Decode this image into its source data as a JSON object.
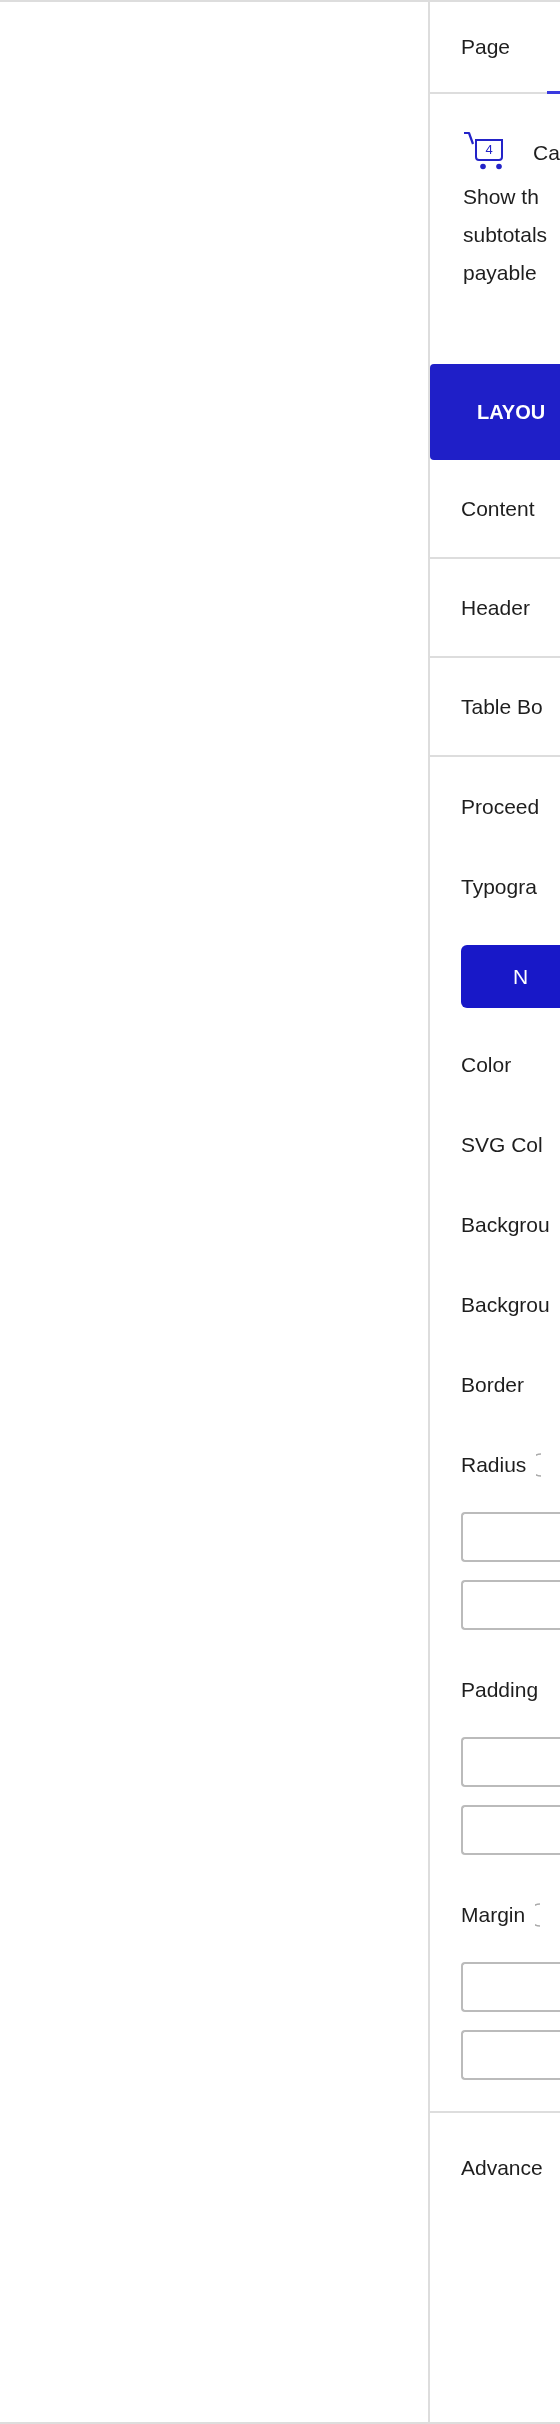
{
  "top_tabs": [
    {
      "label": "Page",
      "selected": false
    },
    {
      "selected": true
    }
  ],
  "widget": {
    "count": "4",
    "title": "Ca",
    "description_lines": [
      "Show th",
      "subtotals",
      "payable"
    ]
  },
  "section_tabs": [
    {
      "label": "LAYOU",
      "selected": true
    }
  ],
  "sections": [
    {
      "label": "Content"
    },
    {
      "label": "Header"
    },
    {
      "label": "Table Bo"
    },
    {
      "label": "Proceed"
    }
  ],
  "proceed_settings": [
    {
      "kind": "label",
      "label": "Typogra"
    },
    {
      "kind": "toggle",
      "label": "N",
      "selected": true
    },
    {
      "kind": "label",
      "label": "Color"
    },
    {
      "kind": "label",
      "label": "SVG Col"
    },
    {
      "kind": "label",
      "label": "Backgrou"
    },
    {
      "kind": "label",
      "label": "Backgrou"
    },
    {
      "kind": "label",
      "label": "Border"
    },
    {
      "kind": "label",
      "label": "Radius",
      "info": true
    },
    {
      "kind": "field"
    },
    {
      "kind": "field"
    },
    {
      "kind": "label",
      "label": "Padding"
    },
    {
      "kind": "field"
    },
    {
      "kind": "field"
    },
    {
      "kind": "label",
      "label": "Margin",
      "info": true
    },
    {
      "kind": "field"
    },
    {
      "kind": "field"
    }
  ],
  "advanced": {
    "label": "Advance"
  }
}
